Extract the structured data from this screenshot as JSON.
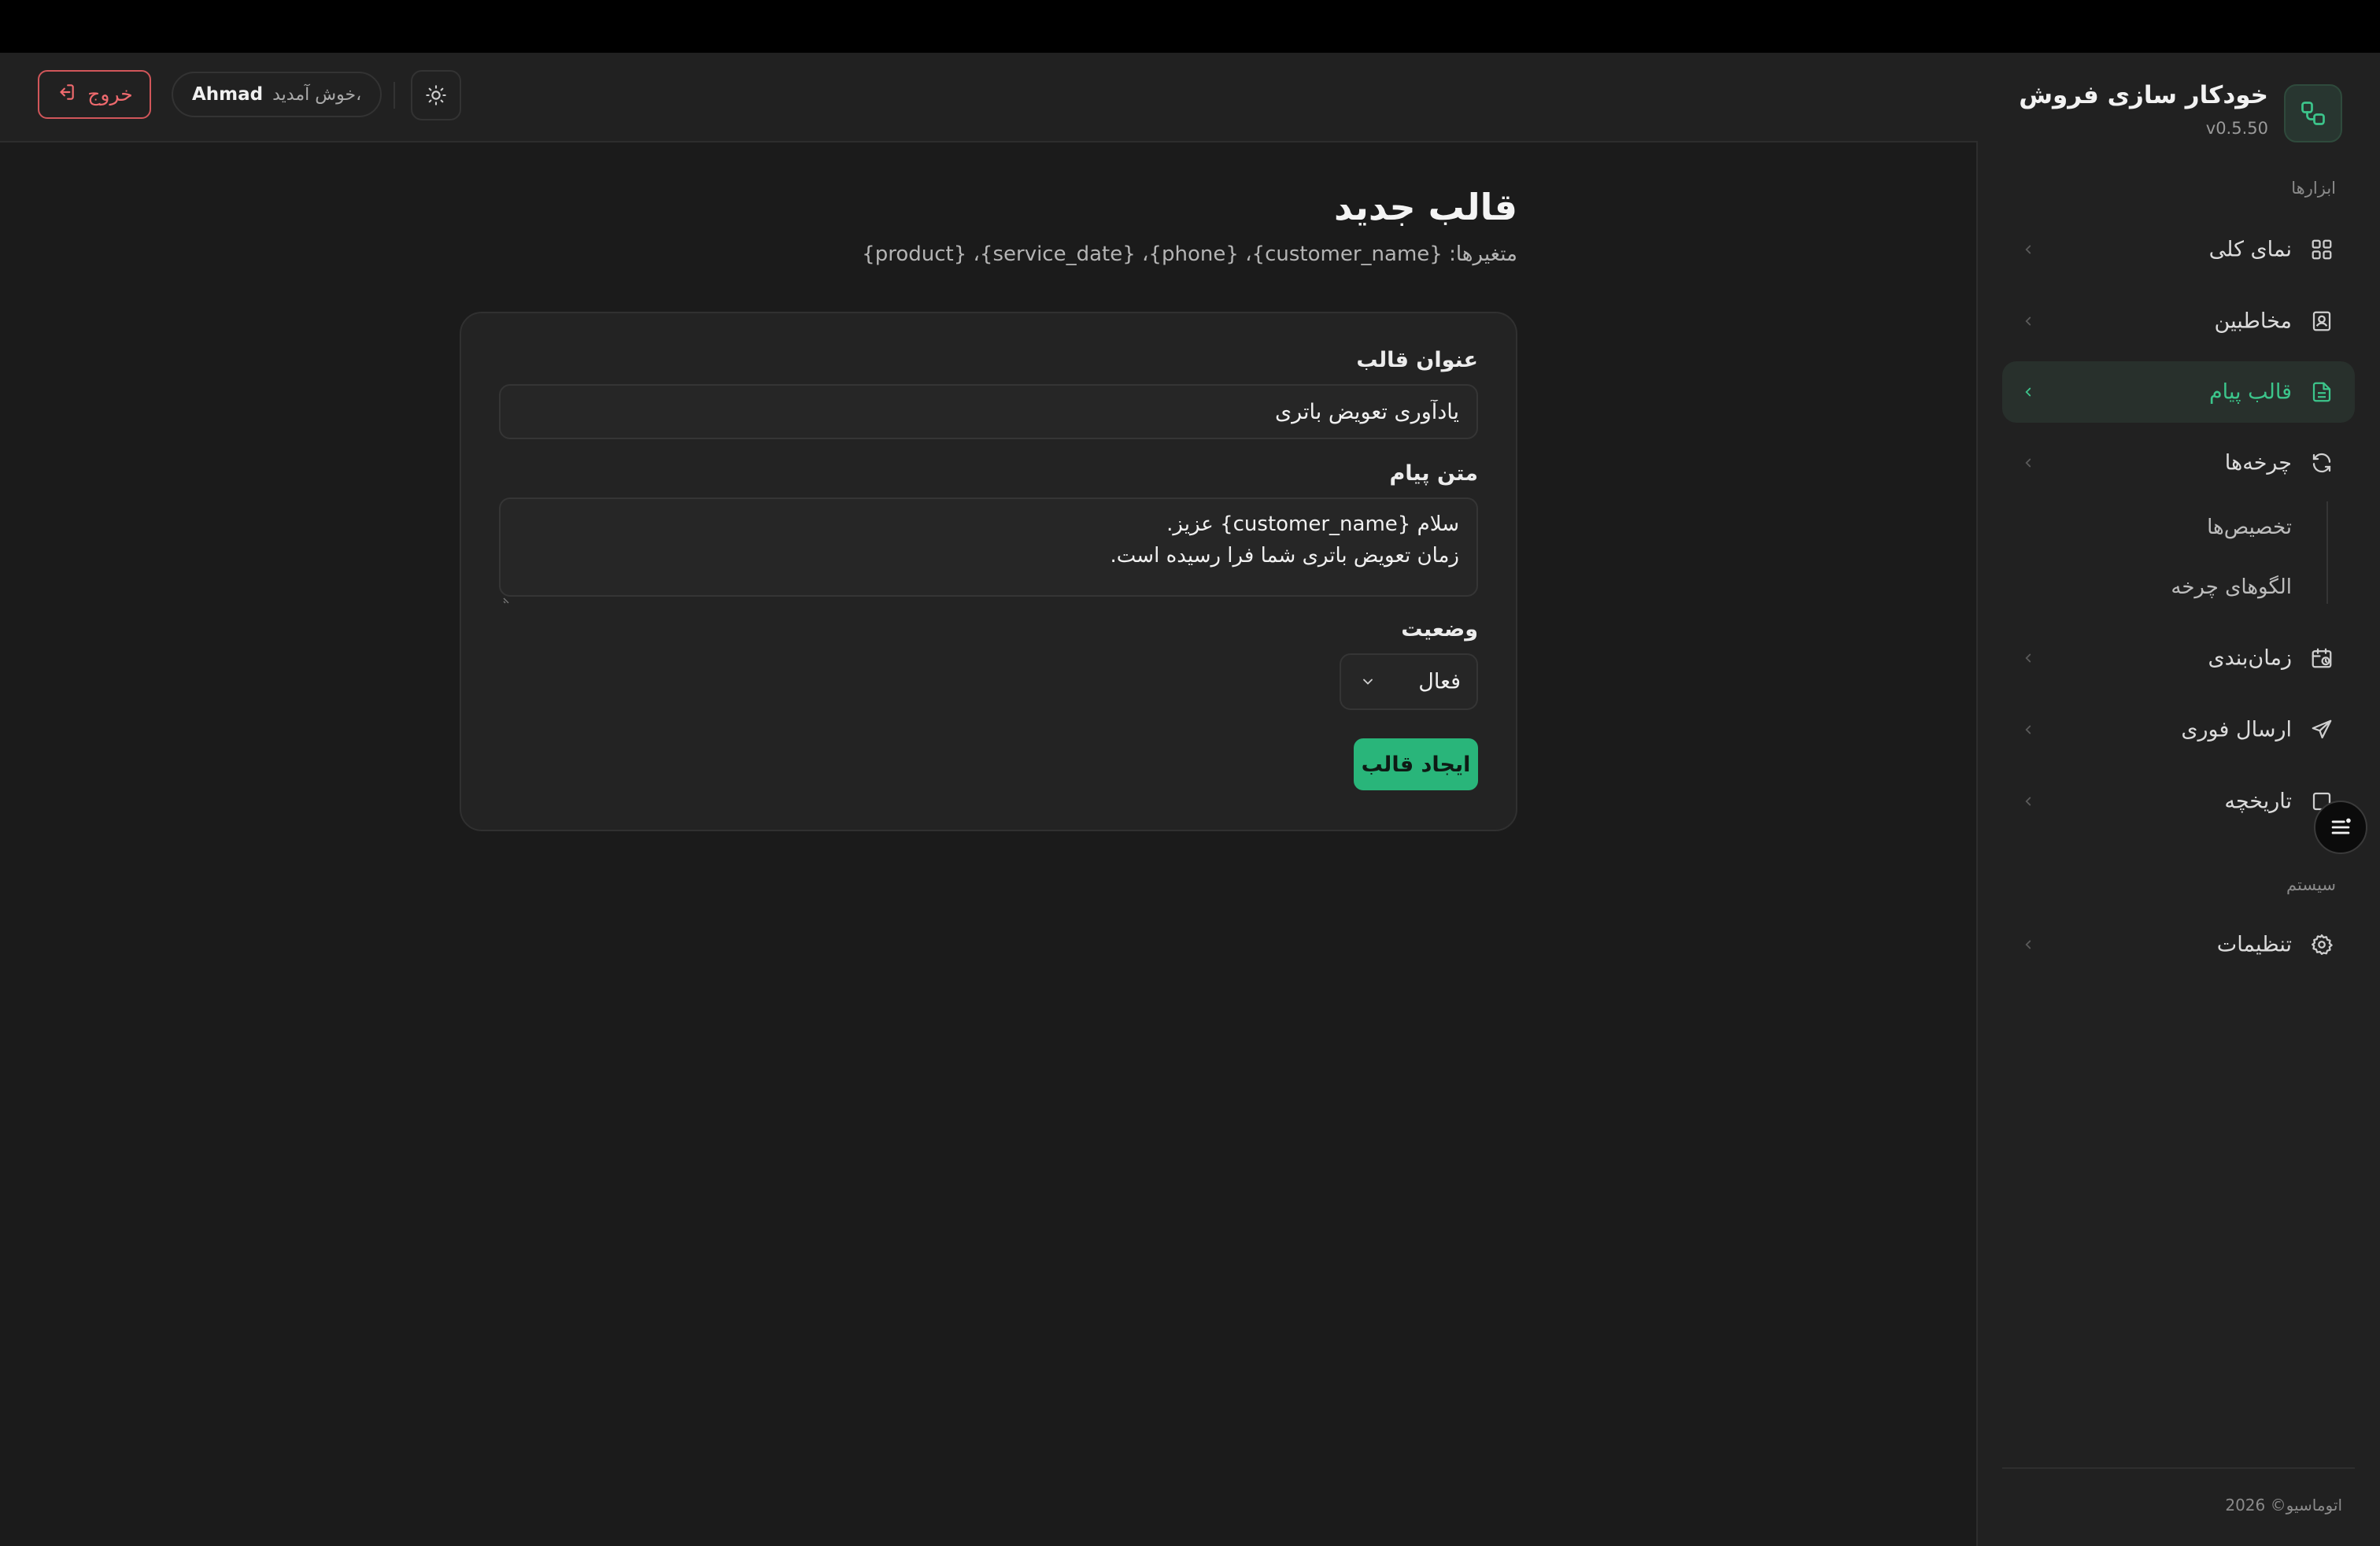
{
  "app": {
    "title": "خودکار سازی فروش",
    "version": "v0.5.50"
  },
  "sidebar": {
    "tools_label": "ابزارها",
    "items": [
      {
        "label": "نمای کلی",
        "icon": "grid-icon"
      },
      {
        "label": "مخاطبین",
        "icon": "contact-card-icon"
      },
      {
        "label": "قالب پیام",
        "icon": "document-icon",
        "active": true
      },
      {
        "label": "چرخه‌ها",
        "icon": "refresh-icon"
      },
      {
        "label": "زمان‌بندی",
        "icon": "calendar-clock-icon"
      },
      {
        "label": "ارسال فوری",
        "icon": "send-icon"
      },
      {
        "label": "تاریخچه",
        "icon": "history-icon"
      }
    ],
    "sub_items": [
      "تخصیص‌ها",
      "الگوهای چرخه"
    ],
    "system_label": "سیستم",
    "settings_label": "تنظیمات",
    "copyright": "اتوماسیو© 2026"
  },
  "header": {
    "logout_label": "خروج",
    "welcome_text": "خوش آمدید،",
    "username": "Ahmad"
  },
  "page": {
    "title": "قالب جدید",
    "subtitle": "متغیرها: {customer_name}، {phone}، {service_date}، {product}"
  },
  "form": {
    "title_label": "عنوان قالب",
    "title_value": "یادآوری تعویض باتری",
    "body_label": "متن پیام",
    "body_line1": "سلام {customer_name} عزیز.",
    "body_line2": "زمان تعویض باتری شما فرا رسیده است.",
    "status_label": "وضعیت",
    "status_value": "فعال",
    "submit_label": "ایجاد قالب"
  },
  "colors": {
    "accent": "#29b57a",
    "active_text": "#3cc58b",
    "danger": "#d1565a",
    "background": "#1b1b1b",
    "panel": "#212121"
  }
}
